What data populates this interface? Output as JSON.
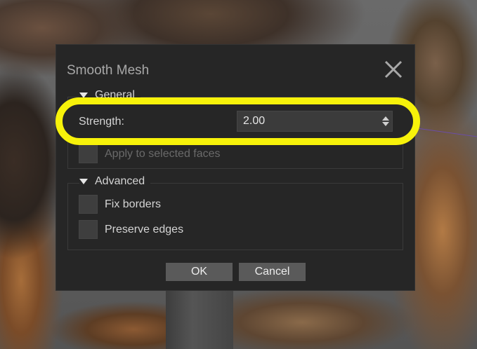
{
  "dialog": {
    "title": "Smooth Mesh",
    "close_icon": "close-icon"
  },
  "general": {
    "title": "General",
    "strength_label": "Strength:",
    "strength_value": "2.00",
    "apply_selected_label": "Apply to selected faces",
    "apply_selected_checked": false
  },
  "advanced": {
    "title": "Advanced",
    "fix_borders_label": "Fix borders",
    "fix_borders_checked": false,
    "preserve_edges_label": "Preserve edges",
    "preserve_edges_checked": false
  },
  "buttons": {
    "ok_label": "OK",
    "cancel_label": "Cancel"
  },
  "colors": {
    "highlight": "#f7f20a",
    "dialog_bg": "#262626"
  }
}
